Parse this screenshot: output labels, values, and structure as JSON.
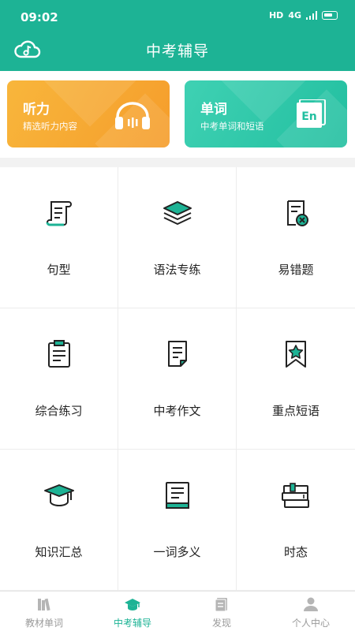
{
  "status": {
    "time": "09:02",
    "hd": "HD",
    "net": "4G"
  },
  "header": {
    "title": "中考辅导"
  },
  "banners": [
    {
      "title": "听力",
      "subtitle": "精选听力内容"
    },
    {
      "title": "单词",
      "subtitle": "中考单词和短语",
      "badge": "En"
    }
  ],
  "grid": [
    {
      "label": "句型",
      "icon": "scroll-icon"
    },
    {
      "label": "语法专练",
      "icon": "layers-icon"
    },
    {
      "label": "易错题",
      "icon": "error-doc-icon"
    },
    {
      "label": "综合练习",
      "icon": "clipboard-icon"
    },
    {
      "label": "中考作文",
      "icon": "document-icon"
    },
    {
      "label": "重点短语",
      "icon": "bookmark-star-icon"
    },
    {
      "label": "知识汇总",
      "icon": "graduation-cap-icon"
    },
    {
      "label": "一词多义",
      "icon": "book-icon"
    },
    {
      "label": "时态",
      "icon": "book-stack-icon"
    }
  ],
  "tabs": [
    {
      "label": "教材单词",
      "active": false
    },
    {
      "label": "中考辅导",
      "active": true
    },
    {
      "label": "发现",
      "active": false
    },
    {
      "label": "个人中心",
      "active": false
    }
  ],
  "colors": {
    "primary": "#1db395",
    "listen": "#f5a52f",
    "word": "#2dc8a8",
    "icon_accent": "#1db395"
  }
}
